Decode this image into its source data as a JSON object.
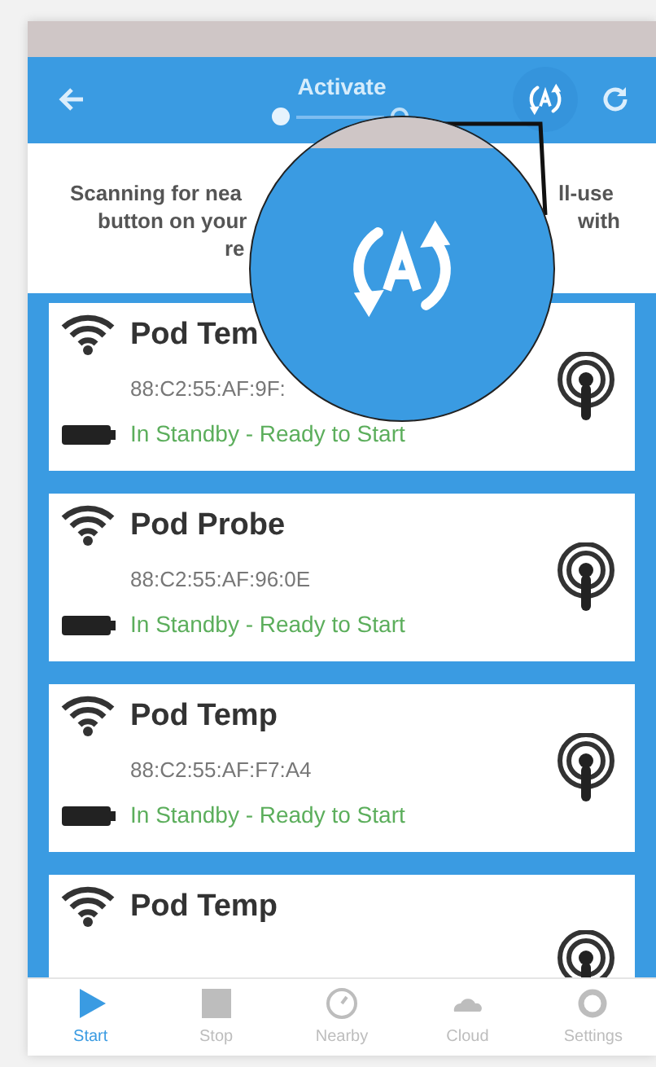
{
  "header": {
    "title": "Activate",
    "steps": [
      {
        "selected": true
      },
      {
        "selected": false
      }
    ]
  },
  "intro": {
    "lines": [
      {
        "left": "Scanning for nea",
        "right": "ll-use"
      },
      {
        "left": "button on your",
        "right": "with"
      },
      {
        "left": "re"
      }
    ]
  },
  "devices": [
    {
      "name": "Pod Tem",
      "mac": "88:C2:55:AF:9F:",
      "status": "In Standby - Ready to Start"
    },
    {
      "name": "Pod Probe",
      "mac": "88:C2:55:AF:96:0E",
      "status": "In Standby - Ready to Start"
    },
    {
      "name": "Pod Temp",
      "mac": "88:C2:55:AF:F7:A4",
      "status": "In Standby - Ready to Start"
    },
    {
      "name": "Pod Temp"
    }
  ],
  "nav": [
    {
      "label": "Start",
      "kind": "play",
      "selected": true
    },
    {
      "label": "Stop",
      "kind": "stop",
      "selected": false
    },
    {
      "label": "Nearby",
      "kind": "gauge",
      "selected": false
    },
    {
      "label": "Cloud",
      "kind": "cloud",
      "selected": false
    },
    {
      "label": "Settings",
      "kind": "gear",
      "selected": false
    }
  ]
}
